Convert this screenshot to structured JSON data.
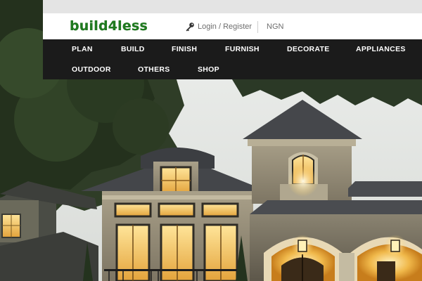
{
  "header": {
    "logo_text": "build4less",
    "login_label": "Login / Register",
    "currency_label": "NGN",
    "icon": "key-icon"
  },
  "nav": {
    "items": [
      {
        "label": "PLAN"
      },
      {
        "label": "BUILD"
      },
      {
        "label": "FINISH"
      },
      {
        "label": "FURNISH"
      },
      {
        "label": "DECORATE"
      },
      {
        "label": "APPLIANCES"
      },
      {
        "label": "OUTDOOR"
      },
      {
        "label": "OTHERS"
      },
      {
        "label": "SHOP"
      }
    ]
  },
  "colors": {
    "logo_green": "#1f7a1f",
    "nav_background": "#1b1b1b",
    "header_background": "#ffffff",
    "top_strip": "#e4e4e4"
  }
}
